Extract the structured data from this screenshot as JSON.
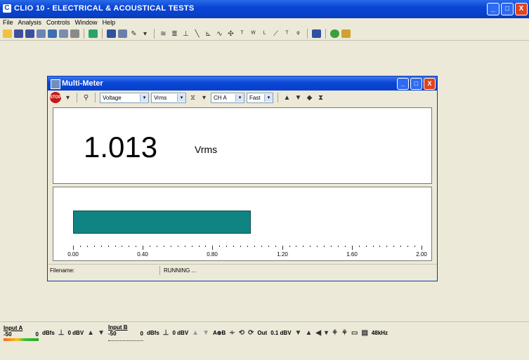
{
  "app": {
    "title": "CLIO 10 - ELECTRICAL & ACOUSTICAL TESTS"
  },
  "menu": [
    "File",
    "Analysis",
    "Controls",
    "Window",
    "Help"
  ],
  "window_buttons": {
    "minimize": "_",
    "maximize": "□",
    "close": "X"
  },
  "multimeter": {
    "title": "Multi-Meter",
    "toolbar": {
      "stop_label": "STOP",
      "measure_select": "Voltage",
      "unit_select": "Vrms",
      "channel_select": "CH A",
      "speed_select": "Fast"
    },
    "reading_value": "1.013",
    "reading_unit": "Vrms",
    "bar_level_value": 1.013,
    "scale_max": 2.0,
    "scale_labels": [
      "0.00",
      "0.40",
      "0.80",
      "1.20",
      "1.60",
      "2.00"
    ],
    "status_filename": "Filename:",
    "status_state": "RUNNING ..."
  },
  "bottom_bar": {
    "input_a_label": "Input A",
    "input_a_scale": "-50",
    "input_a_zero": "0",
    "dbfs_label": "dBfs",
    "input_a_gain": "0 dBV",
    "input_b_label": "Input B",
    "input_b_scale": "-50",
    "input_b_zero": "0",
    "input_b_gain": "0 dBV",
    "ab_label": "A⊕B",
    "out_label": "Out",
    "out_level": "0.1 dBV",
    "sample_rate": "48kHz"
  }
}
